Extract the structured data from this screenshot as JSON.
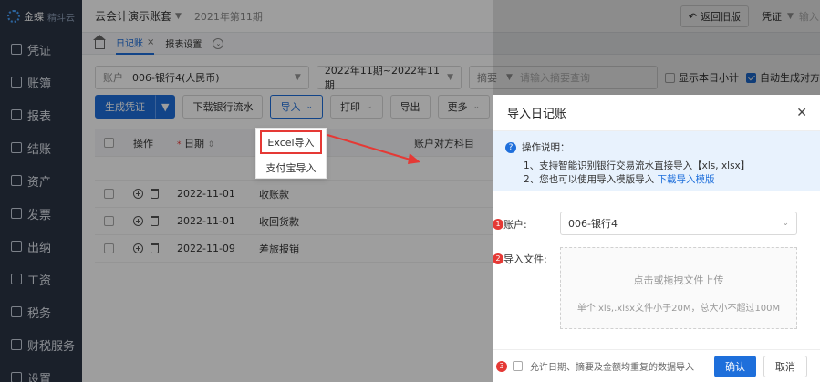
{
  "sidebar": {
    "logo": "金蝶",
    "logo_sub": "精斗云",
    "items": [
      {
        "label": "凭证",
        "icon": "voucher-icon"
      },
      {
        "label": "账簿",
        "icon": "ledger-icon"
      },
      {
        "label": "报表",
        "icon": "report-icon"
      },
      {
        "label": "结账",
        "icon": "close-account-icon"
      },
      {
        "label": "资产",
        "icon": "asset-icon"
      },
      {
        "label": "发票",
        "icon": "invoice-icon"
      },
      {
        "label": "出纳",
        "icon": "cashier-icon"
      },
      {
        "label": "工资",
        "icon": "salary-icon"
      },
      {
        "label": "税务",
        "icon": "tax-icon"
      },
      {
        "label": "财税服务",
        "icon": "service-icon"
      },
      {
        "label": "设置",
        "icon": "settings-icon"
      }
    ]
  },
  "header": {
    "account_set": "云会计演示账套",
    "period": "2021年第11期",
    "back_label": "返回旧版",
    "voucher_label": "凭证",
    "voucher_placeholder": "输入"
  },
  "tabs": {
    "journal": "日记账",
    "close": "×",
    "report_settings": "报表设置"
  },
  "filters": {
    "account_label": "账户",
    "account_value": "006-银行4(人民币)",
    "period_value": "2022年11期~2022年11期",
    "summary_label": "摘要",
    "summary_placeholder": "请输入摘要查询",
    "show_daily": "显示本日小计",
    "auto_gen": "自动生成对方"
  },
  "toolbar": {
    "generate": "生成凭证",
    "download": "下载银行流水",
    "import": "导入",
    "print": "打印",
    "export": "导出",
    "more": "更多"
  },
  "import_menu": {
    "excel": "Excel导入",
    "alipay": "支付宝导入"
  },
  "table": {
    "headers": {
      "op": "操作",
      "date": "日期",
      "acc": "账户对方科目"
    },
    "rows": [
      {
        "date": "2022-11-01",
        "summary": "收账款"
      },
      {
        "date": "2022-11-01",
        "summary": "收回货款"
      },
      {
        "date": "2022-11-09",
        "summary": "差旅报销"
      }
    ]
  },
  "modal": {
    "title": "导入日记账",
    "tip_title": "操作说明：",
    "tip_1": "1、支持智能识别银行交易流水直接导入【xls, xlsx】",
    "tip_2": "2、您也可以使用导入模版导入",
    "tip_link": "下载导入模版",
    "account_label": "账户:",
    "account_value": "006-银行4",
    "file_label": "导入文件:",
    "upload_main": "点击或拖拽文件上传",
    "upload_sub": "单个.xls,.xlsx文件小于20M，总大小不超过100M",
    "allow_dup": "允许日期、摘要及金额均重复的数据导入",
    "confirm": "确认",
    "cancel": "取消",
    "step_1": "1",
    "step_2": "2",
    "step_3": "3"
  },
  "colors": {
    "primary": "#1e6fdb",
    "highlight": "#e53935",
    "sidebar": "#2b3445"
  }
}
